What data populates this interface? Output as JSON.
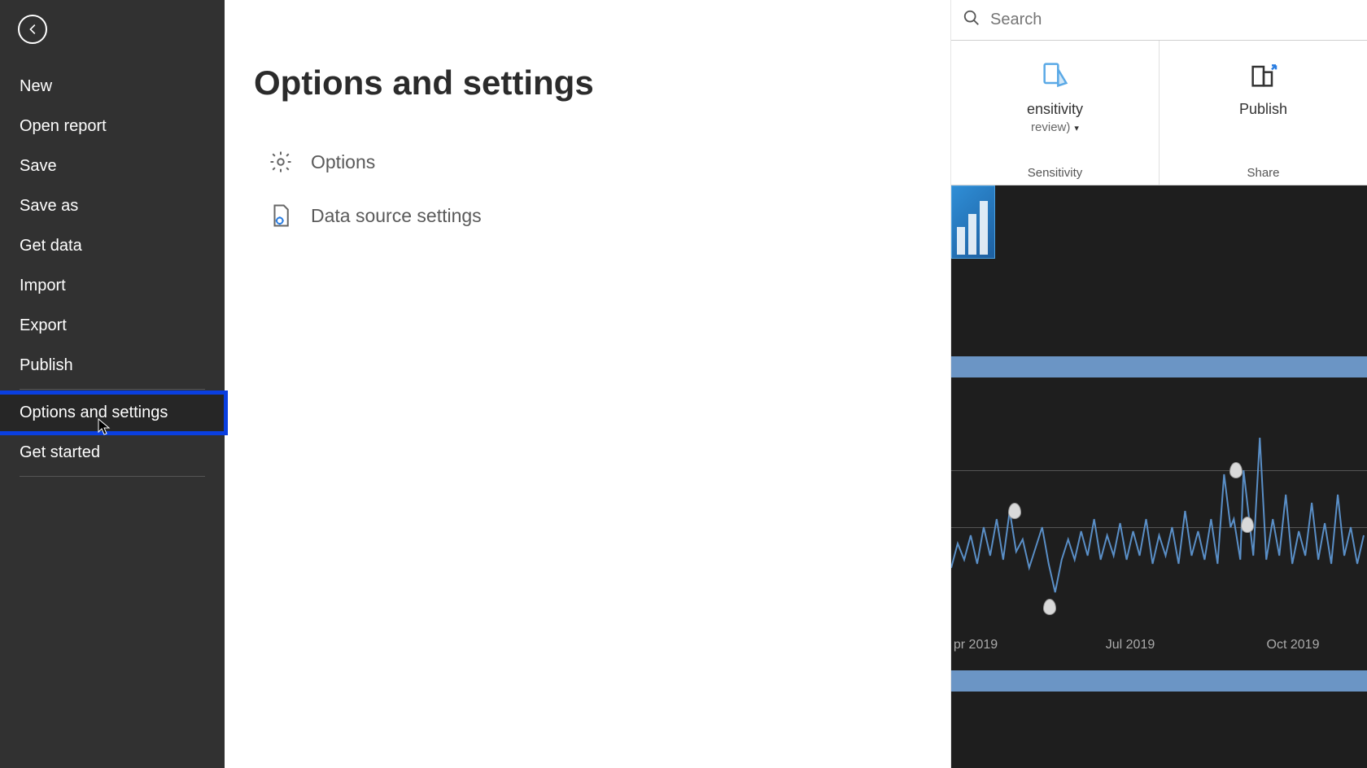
{
  "sidebar": {
    "items": [
      {
        "label": "New"
      },
      {
        "label": "Open report"
      },
      {
        "label": "Save"
      },
      {
        "label": "Save as"
      },
      {
        "label": "Get data"
      },
      {
        "label": "Import"
      },
      {
        "label": "Export"
      },
      {
        "label": "Publish"
      },
      {
        "label": "Options and settings"
      },
      {
        "label": "Get started"
      }
    ]
  },
  "content": {
    "title": "Options and settings",
    "options_label": "Options",
    "dss_label": "Data source settings"
  },
  "search": {
    "placeholder": "Search"
  },
  "ribbon": {
    "sensitivity_partial": "ensitivity",
    "sensitivity_sub_partial": "review)",
    "sensitivity_group": "Sensitivity",
    "publish_label": "Publish",
    "share_group": "Share"
  },
  "chart": {
    "xticks": [
      "pr 2019",
      "Jul 2019",
      "Oct 2019"
    ]
  }
}
